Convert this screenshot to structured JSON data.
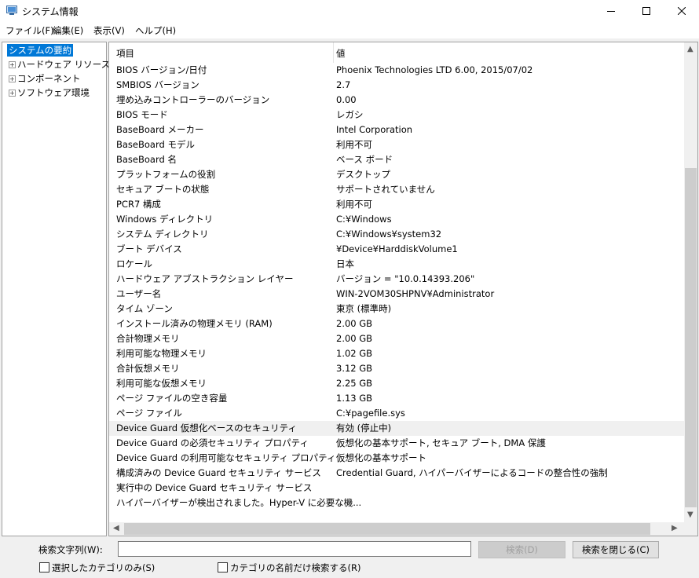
{
  "window": {
    "title": "システム情報",
    "minimize_icon": "minimize-icon",
    "maximize_icon": "maximize-icon",
    "close_icon": "close-icon"
  },
  "menu": [
    "ファイル(F)",
    "編集(E)",
    "表示(V)",
    "ヘルプ(H)"
  ],
  "tree": {
    "selected": "システムの要約",
    "items": [
      {
        "label": "ハードウェア リソース",
        "expander": "+"
      },
      {
        "label": "コンポーネント",
        "expander": "+"
      },
      {
        "label": "ソフトウェア環境",
        "expander": "+"
      }
    ]
  },
  "table": {
    "headers": {
      "item": "項目",
      "value": "値"
    },
    "highlight_index": 24,
    "rows": [
      {
        "name": "BIOS バージョン/日付",
        "value": "Phoenix Technologies LTD 6.00, 2015/07/02"
      },
      {
        "name": "SMBIOS バージョン",
        "value": "2.7"
      },
      {
        "name": "埋め込みコントローラーのバージョン",
        "value": "0.00"
      },
      {
        "name": "BIOS モード",
        "value": "レガシ"
      },
      {
        "name": "BaseBoard メーカー",
        "value": "Intel Corporation"
      },
      {
        "name": "BaseBoard モデル",
        "value": "利用不可"
      },
      {
        "name": "BaseBoard 名",
        "value": "ベース ボード"
      },
      {
        "name": "プラットフォームの役割",
        "value": "デスクトップ"
      },
      {
        "name": "セキュア ブートの状態",
        "value": "サポートされていません"
      },
      {
        "name": "PCR7 構成",
        "value": "利用不可"
      },
      {
        "name": "Windows ディレクトリ",
        "value": "C:¥Windows"
      },
      {
        "name": "システム ディレクトリ",
        "value": "C:¥Windows¥system32"
      },
      {
        "name": "ブート デバイス",
        "value": "¥Device¥HarddiskVolume1"
      },
      {
        "name": "ロケール",
        "value": "日本"
      },
      {
        "name": "ハードウェア アブストラクション レイヤー",
        "value": "バージョン = \"10.0.14393.206\""
      },
      {
        "name": "ユーザー名",
        "value": "WIN-2VOM30SHPNV¥Administrator"
      },
      {
        "name": "タイム ゾーン",
        "value": "東京 (標準時)"
      },
      {
        "name": "インストール済みの物理メモリ (RAM)",
        "value": "2.00 GB"
      },
      {
        "name": "合計物理メモリ",
        "value": "2.00 GB"
      },
      {
        "name": "利用可能な物理メモリ",
        "value": "1.02 GB"
      },
      {
        "name": "合計仮想メモリ",
        "value": "3.12 GB"
      },
      {
        "name": "利用可能な仮想メモリ",
        "value": "2.25 GB"
      },
      {
        "name": "ページ ファイルの空き容量",
        "value": "1.13 GB"
      },
      {
        "name": "ページ ファイル",
        "value": "C:¥pagefile.sys"
      },
      {
        "name": "Device Guard 仮想化ベースのセキュリティ",
        "value": "有効 (停止中)"
      },
      {
        "name": "Device Guard の必須セキュリティ プロパティ",
        "value": "仮想化の基本サポート, セキュア ブート, DMA 保護"
      },
      {
        "name": "Device Guard の利用可能なセキュリティ プロパティ",
        "value": "仮想化の基本サポート"
      },
      {
        "name": "構成済みの Device Guard セキュリティ サービス",
        "value": "Credential Guard, ハイパーバイザーによるコードの整合性の強制"
      },
      {
        "name": "実行中の Device Guard セキュリティ サービス",
        "value": ""
      },
      {
        "name": "ハイパーバイザーが検出されました。Hyper-V に必要な機...",
        "value": ""
      }
    ]
  },
  "search": {
    "label": "検索文字列(W):",
    "value": "",
    "find_button": "検索(D)",
    "close_button": "検索を閉じる(C)",
    "check_selected_category": "選択したカテゴリのみ(S)",
    "check_category_names": "カテゴリの名前だけ検索する(R)"
  }
}
